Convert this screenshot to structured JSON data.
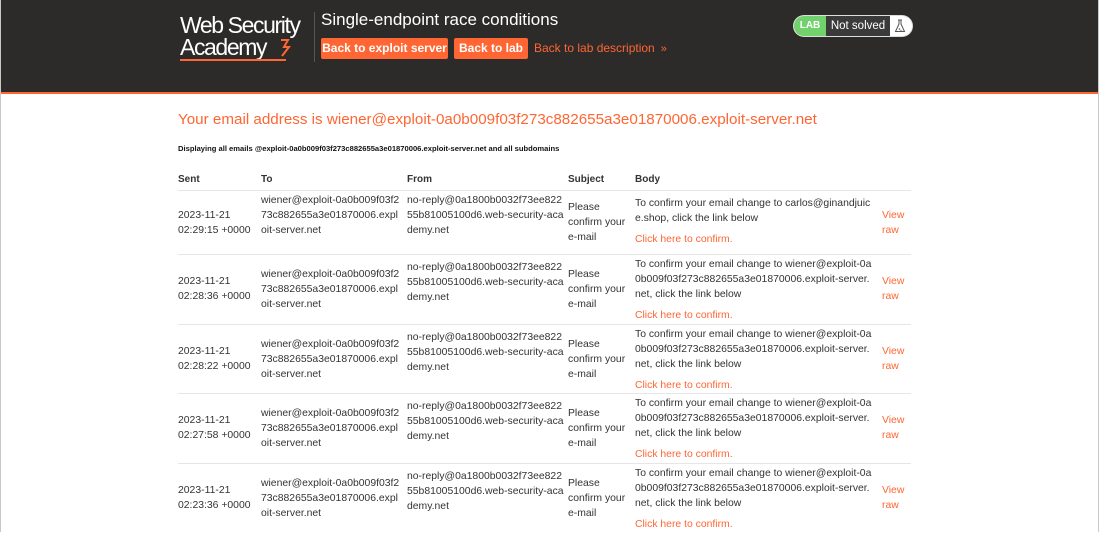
{
  "header": {
    "logo": {
      "line1": "Web Security",
      "line2": "Academy"
    },
    "lab_title": "Single-endpoint race conditions",
    "back_to_exploit": "Back to exploit server",
    "back_to_lab": "Back to lab",
    "back_to_description": "Back to lab description",
    "description_chevron": "»",
    "status": {
      "badge": "LAB",
      "text": "Not solved"
    }
  },
  "email_heading": "Your email address is wiener@exploit-0a0b009f03f273c882655a3e01870006.exploit-server.net",
  "display_note": "Displaying all emails @exploit-0a0b009f03f273c882655a3e01870006.exploit-server.net and all subdomains",
  "table": {
    "headers": [
      "Sent",
      "To",
      "From",
      "Subject",
      "Body"
    ],
    "rows": [
      {
        "sent": "2023-11-21 02:29:15 +0000",
        "to": "wiener@exploit-0a0b009f03f273c882655a3e01870006.exploit-server.net",
        "from": "no-reply@0a1800b0032f73ee82255b81005100d6.web-security-academy.net",
        "subject": "Please confirm your e-mail",
        "body": "To confirm your email change to carlos@ginandjuice.shop, click the link below",
        "link": "Click here to confirm.",
        "view": "View raw"
      },
      {
        "sent": "2023-11-21 02:28:36 +0000",
        "to": "wiener@exploit-0a0b009f03f273c882655a3e01870006.exploit-server.net",
        "from": "no-reply@0a1800b0032f73ee82255b81005100d6.web-security-academy.net",
        "subject": "Please confirm your e-mail",
        "body": "To confirm your email change to wiener@exploit-0a0b009f03f273c882655a3e01870006.exploit-server.net, click the link below",
        "link": "Click here to confirm.",
        "view": "View raw"
      },
      {
        "sent": "2023-11-21 02:28:22 +0000",
        "to": "wiener@exploit-0a0b009f03f273c882655a3e01870006.exploit-server.net",
        "from": "no-reply@0a1800b0032f73ee82255b81005100d6.web-security-academy.net",
        "subject": "Please confirm your e-mail",
        "body": "To confirm your email change to wiener@exploit-0a0b009f03f273c882655a3e01870006.exploit-server.net, click the link below",
        "link": "Click here to confirm.",
        "view": "View raw"
      },
      {
        "sent": "2023-11-21 02:27:58 +0000",
        "to": "wiener@exploit-0a0b009f03f273c882655a3e01870006.exploit-server.net",
        "from": "no-reply@0a1800b0032f73ee82255b81005100d6.web-security-academy.net",
        "subject": "Please confirm your e-mail",
        "body": "To confirm your email change to wiener@exploit-0a0b009f03f273c882655a3e01870006.exploit-server.net, click the link below",
        "link": "Click here to confirm.",
        "view": "View raw"
      },
      {
        "sent": "2023-11-21 02:23:36 +0000",
        "to": "wiener@exploit-0a0b009f03f273c882655a3e01870006.exploit-server.net",
        "from": "no-reply@0a1800b0032f73ee82255b81005100d6.web-security-academy.net",
        "subject": "Please confirm your e-mail",
        "body": "To confirm your email change to wiener@exploit-0a0b009f03f273c882655a3e01870006.exploit-server.net, click the link below",
        "link": "Click here to confirm.",
        "view": "View raw"
      }
    ]
  },
  "colors": {
    "accent": "#ff6633",
    "header_bg": "#2c2b2a",
    "lab_badge": "#70d16d"
  },
  "icons": {
    "logo_bolt": "lightning-bolt-icon",
    "status_flask": "flask-icon",
    "description_chevron": "double-chevron-right-icon"
  }
}
